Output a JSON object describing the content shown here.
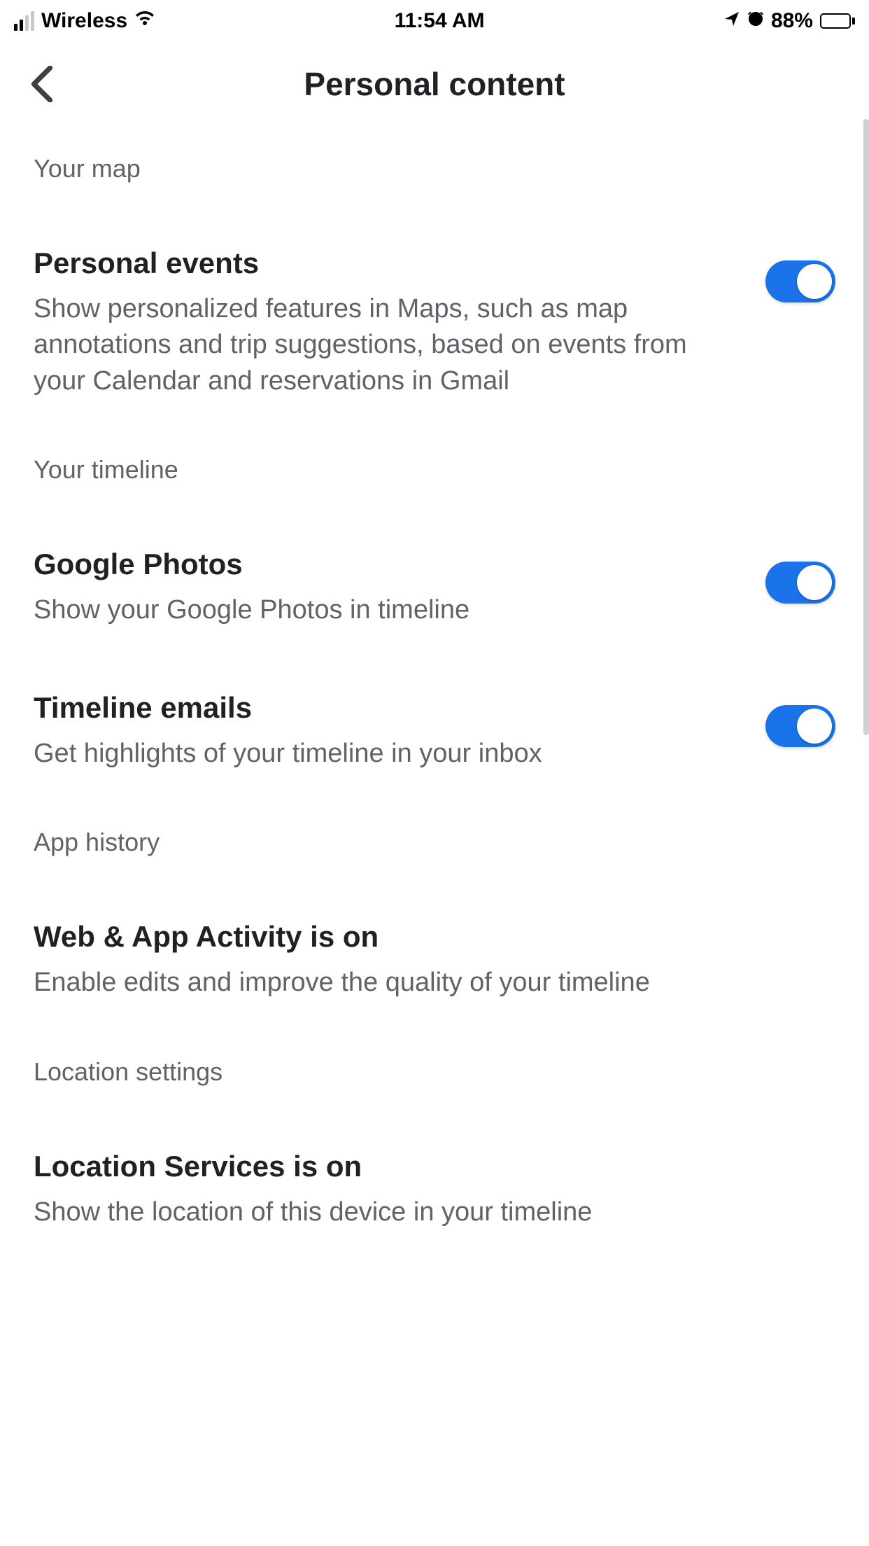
{
  "status_bar": {
    "carrier": "Wireless",
    "time": "11:54 AM",
    "battery_pct": "88%"
  },
  "header": {
    "title": "Personal content"
  },
  "sections": {
    "your_map": {
      "header": "Your map",
      "personal_events": {
        "title": "Personal events",
        "desc": "Show personalized features in Maps, such as map annotations and trip suggestions, based on events from your Calendar and reservations in Gmail",
        "on": true
      }
    },
    "your_timeline": {
      "header": "Your timeline",
      "google_photos": {
        "title": "Google Photos",
        "desc": "Show your Google Photos in timeline",
        "on": true
      },
      "timeline_emails": {
        "title": "Timeline emails",
        "desc": "Get highlights of your timeline in your inbox",
        "on": true
      }
    },
    "app_history": {
      "header": "App history",
      "web_app_activity": {
        "title": "Web & App Activity is on",
        "desc": "Enable edits and improve the quality of your timeline"
      }
    },
    "location_settings": {
      "header": "Location settings",
      "location_services": {
        "title": "Location Services is on",
        "desc": "Show the location of this device in your timeline"
      }
    }
  }
}
